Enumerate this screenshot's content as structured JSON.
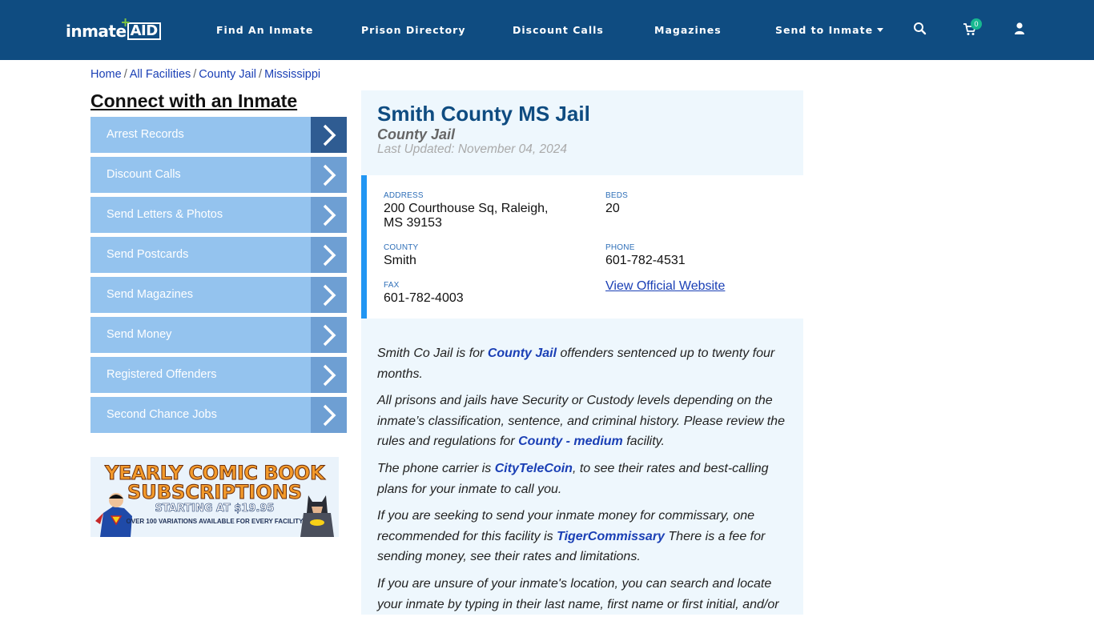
{
  "header": {
    "logo_text": "inmate",
    "logo_accent": "AID",
    "nav": [
      {
        "label": "Find An Inmate"
      },
      {
        "label": "Prison Directory"
      },
      {
        "label": "Discount Calls"
      },
      {
        "label": "Magazines"
      },
      {
        "label": "Send to Inmate"
      }
    ],
    "cart_count": "0",
    "icons": [
      "search-icon",
      "cart-icon",
      "user-icon"
    ]
  },
  "breadcrumb": [
    "Home",
    "All Facilities",
    "County Jail",
    "Mississippi"
  ],
  "sidebar": {
    "title": "Connect with an Inmate",
    "items": [
      {
        "label": "Arrest Records"
      },
      {
        "label": "Discount Calls"
      },
      {
        "label": "Send Letters & Photos"
      },
      {
        "label": "Send Postcards"
      },
      {
        "label": "Send Magazines"
      },
      {
        "label": "Send Money"
      },
      {
        "label": "Registered Offenders"
      },
      {
        "label": "Second Chance Jobs"
      }
    ],
    "banner": {
      "line1": "YEARLY COMIC BOOK",
      "line2": "SUBSCRIPTIONS",
      "line3": "STARTING AT $19.95",
      "line4": "OVER 100 VARIATIONS AVAILABLE FOR EVERY FACILITY"
    }
  },
  "facility": {
    "name": "Smith County MS Jail",
    "type": "County Jail",
    "updated": "Last Updated: November 04, 2024",
    "address_label": "ADDRESS",
    "address_line1": "200 Courthouse Sq, Raleigh,",
    "address_line2": "MS 39153",
    "beds_label": "BEDS",
    "beds": "20",
    "county_label": "COUNTY",
    "county": "Smith",
    "phone_label": "PHONE",
    "phone": "601-782-4531",
    "fax_label": "FAX",
    "fax": "601-782-4003",
    "website_link": "View Official Website"
  },
  "body": {
    "p1_pre": "Smith Co Jail is for ",
    "p1_link": "County Jail",
    "p1_post": " offenders sentenced up to twenty four months.",
    "p2_pre": "All prisons and jails have Security or Custody levels depending on the inmate’s classification, sentence, and criminal history. Please review the rules and regulations for ",
    "p2_link": "County - medium",
    "p2_post": " facility.",
    "p3_pre": "The phone carrier is ",
    "p3_link": "CityTeleCoin",
    "p3_post": ", to see their rates and best-calling plans for your inmate to call you.",
    "p4_pre": "If you are seeking to send your inmate money for commissary, one recommended for this facility is ",
    "p4_link": "TigerCommissary",
    "p4_post": " There is a fee for sending money, see their rates and limitations.",
    "p5": "If you are unsure of your inmate's location, you can search and locate your inmate by typing in their last name, first name or first initial, and/or"
  },
  "colors": {
    "header_bg": "#0f4c81",
    "side_item": "#94c3ee",
    "side_arrow": "#6e9fd3",
    "info_accent": "#2196f3",
    "link": "#1a3fb5"
  }
}
